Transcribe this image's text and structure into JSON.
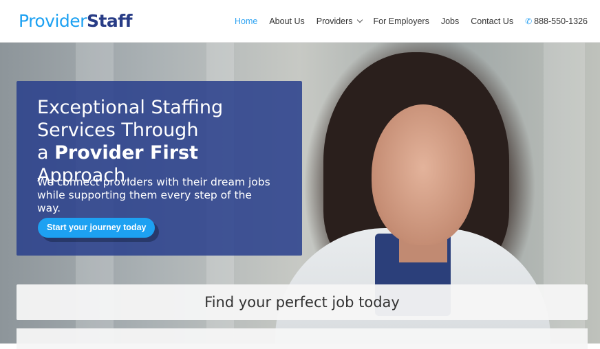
{
  "header": {
    "logo_part1": "Provider",
    "logo_part2": "Staff",
    "nav": [
      {
        "label": "Home",
        "active": true
      },
      {
        "label": "About Us"
      },
      {
        "label": "Providers"
      },
      {
        "label": "For Employers"
      },
      {
        "label": "Jobs"
      },
      {
        "label": "Contact Us"
      }
    ],
    "phone": "888-550-1326",
    "phone_icon": "phone-icon"
  },
  "hero": {
    "headline_line1": "Exceptional Staffing",
    "headline_line2": "Services Through",
    "headline_line3_pre": "a ",
    "headline_line3_bold": "Provider First",
    "headline_line3_post": " Approach.",
    "subline": "We connect providers with their dream jobs while supporting them every step of the way.",
    "cta_label": "Start your journey today"
  },
  "find": {
    "title": "Find your perfect job today"
  },
  "colors": {
    "accent": "#1da1f2",
    "brand_dark": "#283c86",
    "overlay": "#293f8c",
    "nav_active": "#2ea3f2"
  }
}
